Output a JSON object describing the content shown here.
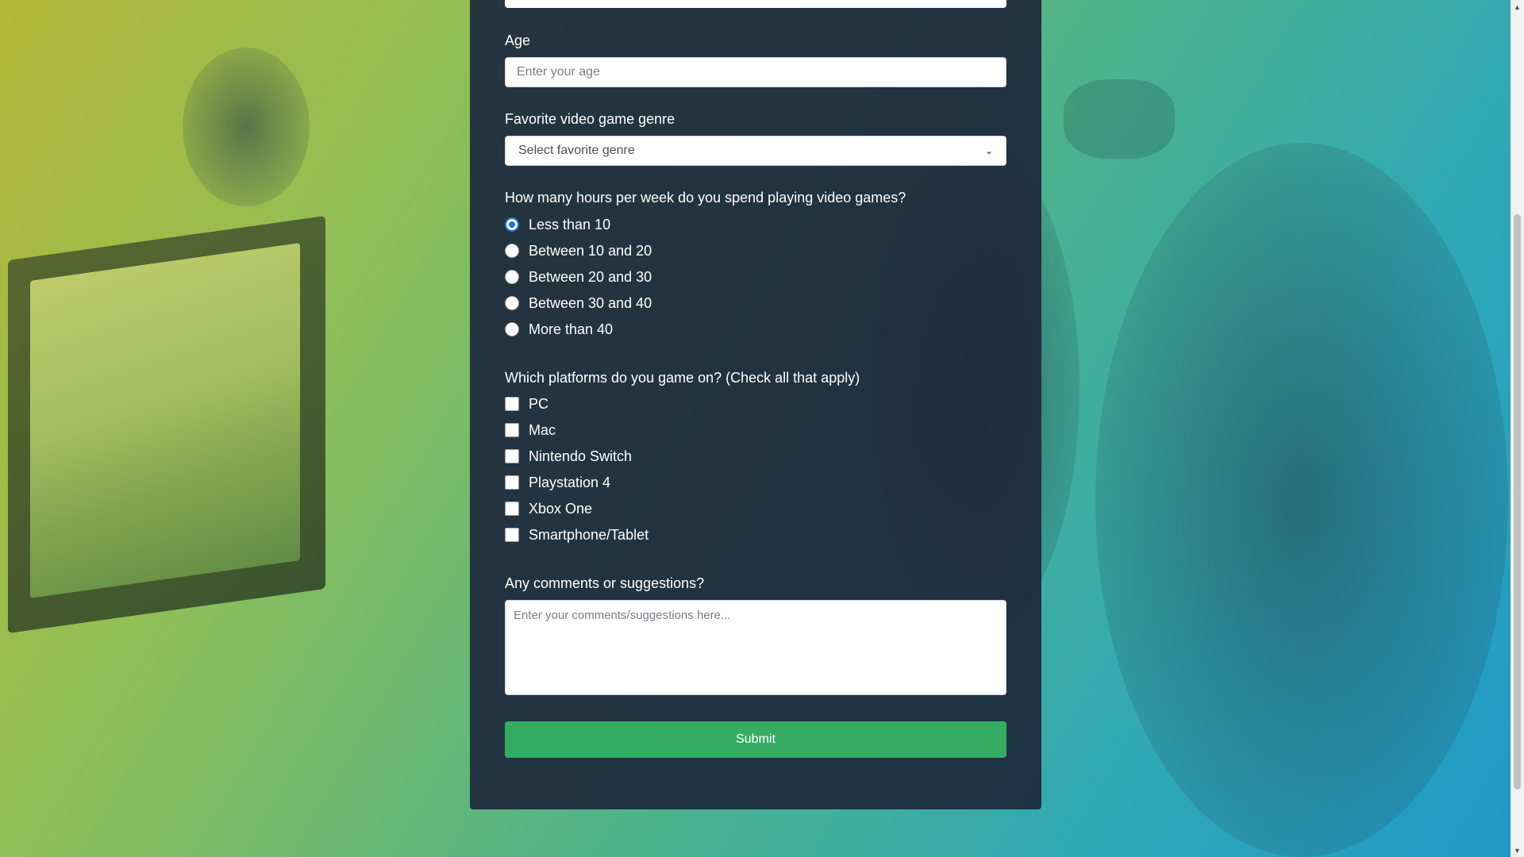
{
  "form": {
    "age_label": "Age",
    "age_placeholder": "Enter your age",
    "genre_label": "Favorite video game genre",
    "genre_selected": "Select favorite genre",
    "hours_label": "How many hours per week do you spend playing video games?",
    "hours_options": [
      {
        "label": "Less than 10",
        "checked": true
      },
      {
        "label": "Between 10 and 20",
        "checked": false
      },
      {
        "label": "Between 20 and 30",
        "checked": false
      },
      {
        "label": "Between 30 and 40",
        "checked": false
      },
      {
        "label": "More than 40",
        "checked": false
      }
    ],
    "platforms_label": "Which platforms do you game on? (Check all that apply)",
    "platform_options": [
      {
        "label": "PC",
        "checked": false
      },
      {
        "label": "Mac",
        "checked": false
      },
      {
        "label": "Nintendo Switch",
        "checked": false
      },
      {
        "label": "Playstation 4",
        "checked": false
      },
      {
        "label": "Xbox One",
        "checked": false
      },
      {
        "label": "Smartphone/Tablet",
        "checked": false
      }
    ],
    "comments_label": "Any comments or suggestions?",
    "comments_placeholder": "Enter your comments/suggestions here...",
    "submit_label": "Submit"
  },
  "icons": {
    "select_chevron": "chevron-down-icon",
    "scroll_up": "arrow-up-icon",
    "scroll_down": "arrow-down-icon"
  },
  "colors": {
    "card_bg": "#1c283c",
    "submit_bg": "#34ad63",
    "radio_accent": "#1a73e8"
  }
}
